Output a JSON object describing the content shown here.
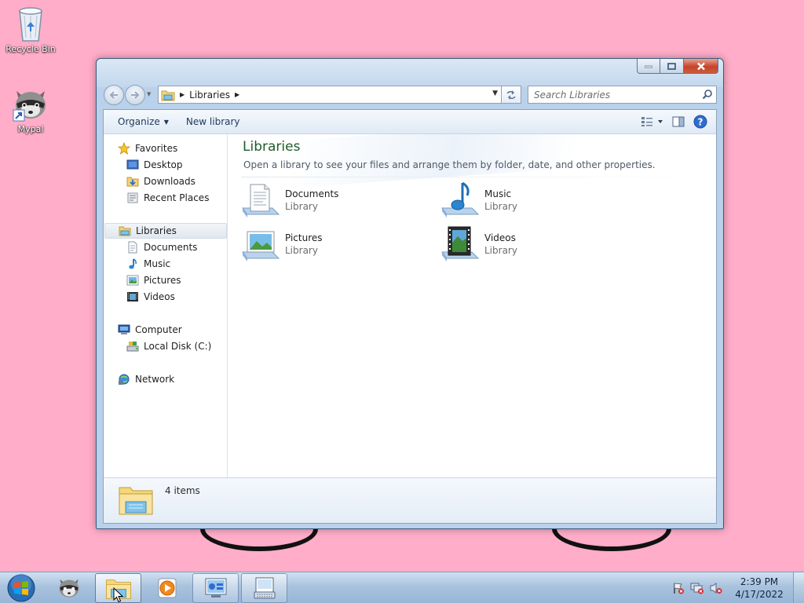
{
  "desktop": {
    "icons": [
      {
        "label": "Recycle Bin",
        "icon": "recycle-bin-icon"
      },
      {
        "label": "Mypal",
        "icon": "mypal-raccoon-icon"
      }
    ]
  },
  "window": {
    "address": {
      "breadcrumb": [
        "Libraries"
      ]
    },
    "search": {
      "placeholder": "Search Libraries"
    },
    "toolbar": {
      "organize_label": "Organize",
      "new_library_label": "New library"
    },
    "navigation": {
      "favorites": {
        "label": "Favorites",
        "items": [
          "Desktop",
          "Downloads",
          "Recent Places"
        ]
      },
      "libraries": {
        "label": "Libraries",
        "items": [
          "Documents",
          "Music",
          "Pictures",
          "Videos"
        ]
      },
      "computer": {
        "label": "Computer",
        "items": [
          "Local Disk (C:)"
        ]
      },
      "network": {
        "label": "Network"
      }
    },
    "content": {
      "title": "Libraries",
      "subtitle": "Open a library to see your files and arrange them by folder, date, and other properties.",
      "items": [
        {
          "name": "Documents",
          "type": "Library",
          "icon": "documents-library-icon"
        },
        {
          "name": "Music",
          "type": "Library",
          "icon": "music-library-icon"
        },
        {
          "name": "Pictures",
          "type": "Library",
          "icon": "pictures-library-icon"
        },
        {
          "name": "Videos",
          "type": "Library",
          "icon": "videos-library-icon"
        }
      ]
    },
    "details": {
      "count_text": "4 items"
    }
  },
  "taskbar": {
    "apps": [
      "start-orb-icon",
      "mypal-icon",
      "windows-explorer-icon",
      "media-player-icon",
      "control-panel-icon",
      "on-screen-keyboard-icon"
    ],
    "clock": {
      "time": "2:39 PM",
      "date": "4/17/2022"
    }
  },
  "colors": {
    "desktop_bg": "#ffadc9",
    "content_title": "#1e5b2a",
    "command_text": "#1e395b",
    "close_button": "#c7432a"
  }
}
